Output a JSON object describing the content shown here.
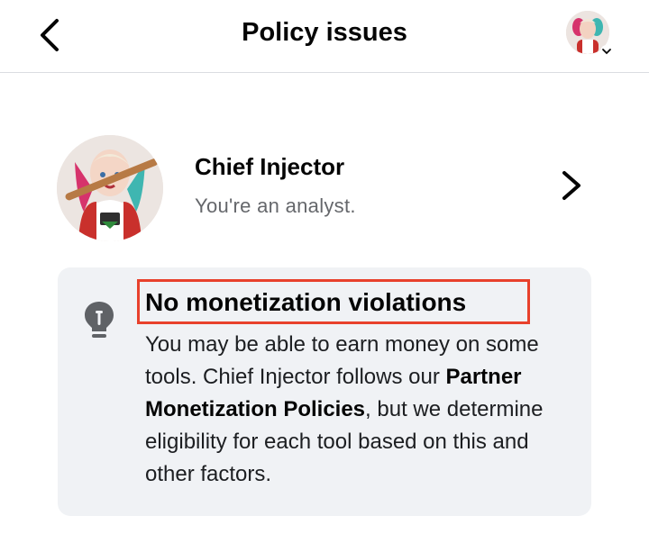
{
  "header": {
    "title": "Policy issues",
    "back_icon": "chevron-left-icon",
    "account_icon": "chevron-down-icon"
  },
  "profile": {
    "name": "Chief Injector",
    "role": "You're an analyst.",
    "chevron_icon": "chevron-right-icon"
  },
  "notice": {
    "icon": "lightbulb-icon",
    "heading": "No monetization violations",
    "body_before": "You may be able to earn money on some tools. Chief Injector follows our ",
    "policy_link": "Partner Monetization Policies",
    "body_after": ", but we determine eligibility for each tool based on this and other factors.",
    "highlight_color": "#e8412c",
    "background_color": "#f0f2f5"
  }
}
